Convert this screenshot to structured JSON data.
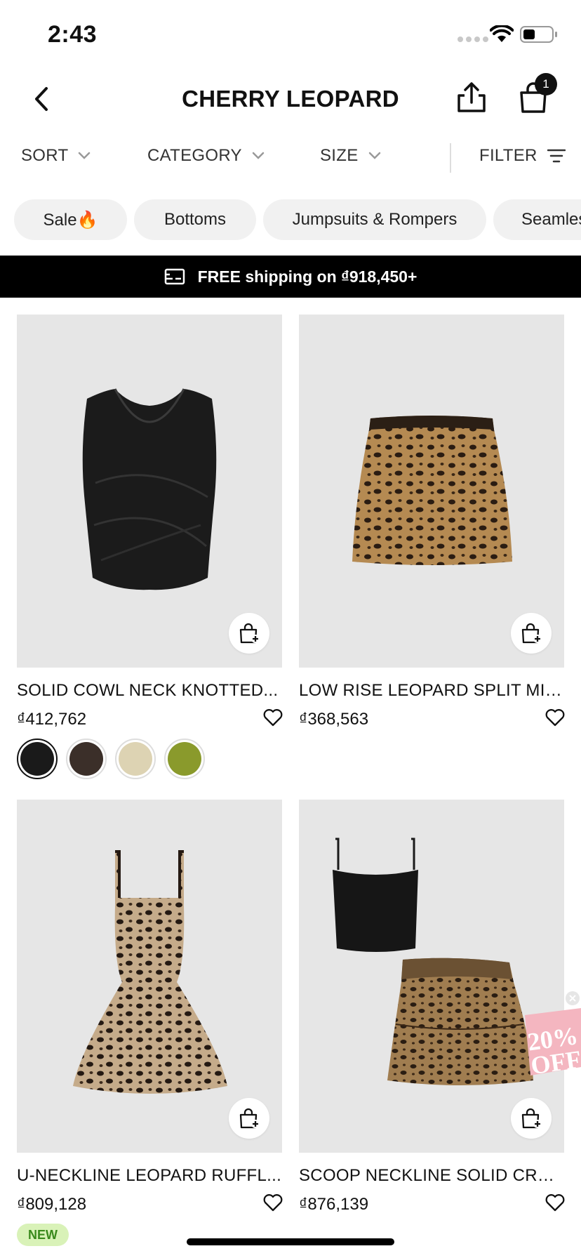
{
  "status_bar": {
    "time": "2:43"
  },
  "nav": {
    "title": "CHERRY LEOPARD",
    "cart_count": "1"
  },
  "filters": {
    "sort": "SORT",
    "category": "CATEGORY",
    "size": "SIZE",
    "filter": "FILTER"
  },
  "chips": [
    "Sale🔥",
    "Bottoms",
    "Jumpsuits & Rompers",
    "Seamles"
  ],
  "banner": {
    "text": "FREE shipping on ₫918,450+"
  },
  "products": [
    {
      "name": "SOLID COWL NECK KNOTTED...",
      "price": "₫412,762",
      "swatch_colors": [
        "#1a1a1a",
        "#3b2f29",
        "#ddd3b3",
        "#8a9a2c"
      ]
    },
    {
      "name": "LOW RISE LEOPARD SPLIT MIN...",
      "price": "₫368,563"
    },
    {
      "name": "U-NECKLINE LEOPARD RUFFL...",
      "price": "₫809,128",
      "badge": "NEW"
    },
    {
      "name": "SCOOP NECKLINE SOLID CRO...",
      "price": "₫876,139"
    }
  ],
  "promo": {
    "text": "20% OFF"
  }
}
